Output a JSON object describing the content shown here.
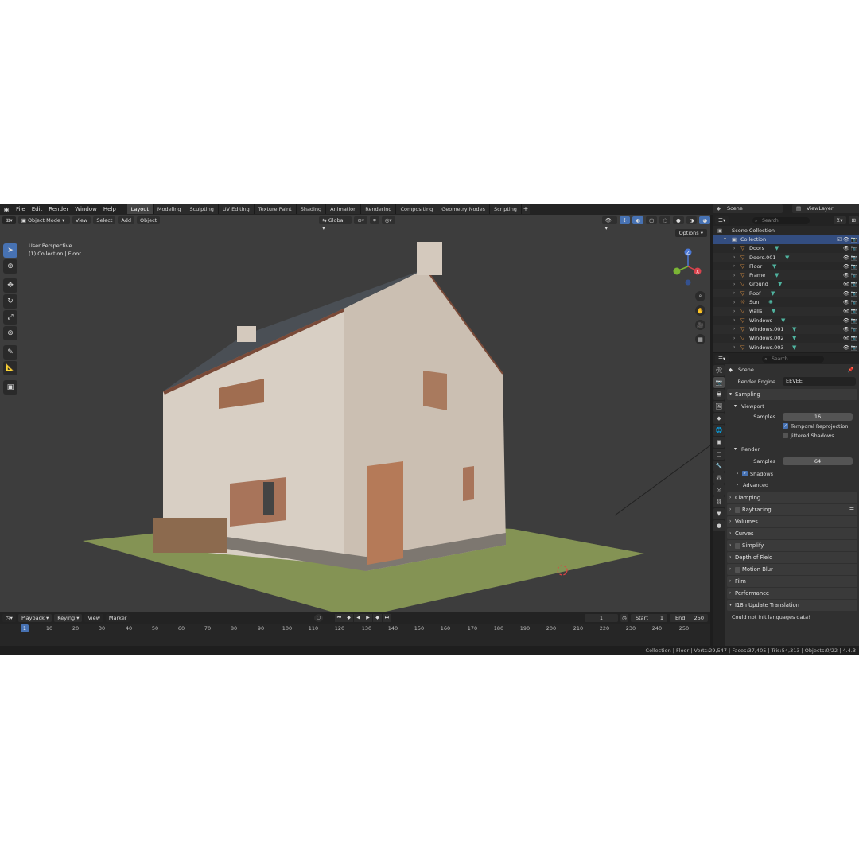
{
  "menu": {
    "items": [
      "File",
      "Edit",
      "Render",
      "Window",
      "Help"
    ]
  },
  "workspaces": [
    "Layout",
    "Modeling",
    "Sculpting",
    "UV Editing",
    "Texture Paint",
    "Shading",
    "Animation",
    "Rendering",
    "Compositing",
    "Geometry Nodes",
    "Scripting"
  ],
  "active_workspace": "Layout",
  "scene_name": "Scene",
  "view_layer": "ViewLayer",
  "viewport": {
    "mode": "Object Mode",
    "menus": [
      "View",
      "Select",
      "Add",
      "Object"
    ],
    "transform_orientation": "Global",
    "options_label": "Options",
    "info_line1": "User Perspective",
    "info_line2": "(1) Collection | Floor",
    "gizmo_axes": {
      "x": "X",
      "y": "Y",
      "z": "Z"
    }
  },
  "outliner": {
    "search_placeholder": "Search",
    "root": "Scene Collection",
    "collection": "Collection",
    "items": [
      "Doors",
      "Doors.001",
      "Floor",
      "Frame",
      "Ground",
      "Roof",
      "Sun",
      "walls",
      "Windows",
      "Windows.001",
      "Windows.002",
      "Windows.003"
    ]
  },
  "properties": {
    "search_placeholder": "Search",
    "context": "Scene",
    "render_engine_label": "Render Engine",
    "render_engine_value": "EEVEE",
    "sampling": "Sampling",
    "viewport_sub": "Viewport",
    "samples_label": "Samples",
    "viewport_samples": "16",
    "temporal_reprojection": "Temporal Reprojection",
    "jittered_shadows": "Jittered Shadows",
    "render_sub": "Render",
    "render_samples": "64",
    "shadows": "Shadows",
    "advanced": "Advanced",
    "panels": [
      "Clamping",
      "Raytracing",
      "Volumes",
      "Curves",
      "Simplify",
      "Depth of Field",
      "Motion Blur",
      "Film",
      "Performance",
      "I18n Update Translation"
    ],
    "message": "Could not init languages data!"
  },
  "timeline": {
    "menus": [
      "Playback",
      "Keying",
      "View",
      "Marker"
    ],
    "current_frame": "1",
    "start_label": "Start",
    "start_value": "1",
    "end_label": "End",
    "end_value": "250",
    "ticks": [
      "1",
      "10",
      "20",
      "30",
      "40",
      "50",
      "60",
      "70",
      "80",
      "90",
      "100",
      "110",
      "120",
      "130",
      "140",
      "150",
      "160",
      "170",
      "180",
      "190",
      "200",
      "210",
      "220",
      "230",
      "240",
      "250"
    ]
  },
  "statusbar": {
    "text": "Collection | Floor | Verts:29,547 | Faces:37,405 | Tris:54,313 | Objects:0/22 | 4.4.3"
  },
  "colors": {
    "accent": "#4772b3",
    "object_icon": "#e39443",
    "mesh_data": "#4fb39f",
    "viewport_bg": "#3d3d3d"
  }
}
